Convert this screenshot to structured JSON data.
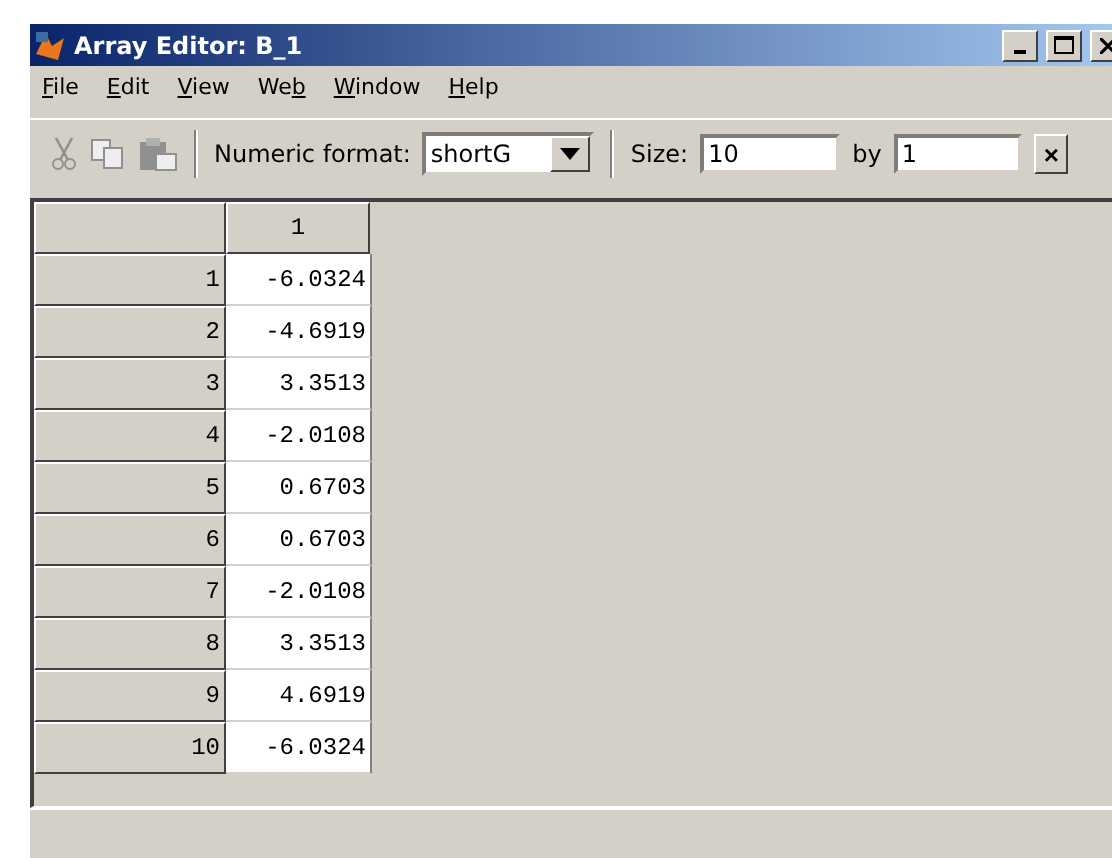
{
  "window": {
    "title": "Array Editor: B_1"
  },
  "menu": [
    {
      "parts": [
        {
          "text": "F",
          "underlined": true
        },
        {
          "text": "ile",
          "underlined": false
        }
      ]
    },
    {
      "parts": [
        {
          "text": "E",
          "underlined": true
        },
        {
          "text": "dit",
          "underlined": false
        }
      ]
    },
    {
      "parts": [
        {
          "text": "V",
          "underlined": true
        },
        {
          "text": "iew",
          "underlined": false
        }
      ]
    },
    {
      "parts": [
        {
          "text": "We",
          "underlined": false
        },
        {
          "text": "b",
          "underlined": true
        }
      ]
    },
    {
      "parts": [
        {
          "text": "W",
          "underlined": true
        },
        {
          "text": "indow",
          "underlined": false
        }
      ]
    },
    {
      "parts": [
        {
          "text": "H",
          "underlined": true
        },
        {
          "text": "elp",
          "underlined": false
        }
      ]
    }
  ],
  "toolbar": {
    "format_label": "Numeric format:",
    "format_value": "shortG",
    "size_label": "Size:",
    "rows_value": "10",
    "by_label": "by",
    "cols_value": "1",
    "close": "×"
  },
  "table": {
    "columns": [
      "1"
    ],
    "rows": [
      {
        "index": "1",
        "value": "-6.0324"
      },
      {
        "index": "2",
        "value": "-4.6919"
      },
      {
        "index": "3",
        "value": "3.3513"
      },
      {
        "index": "4",
        "value": "-2.0108"
      },
      {
        "index": "5",
        "value": "0.6703"
      },
      {
        "index": "6",
        "value": "0.6703"
      },
      {
        "index": "7",
        "value": "-2.0108"
      },
      {
        "index": "8",
        "value": "3.3513"
      },
      {
        "index": "9",
        "value": "4.6919"
      },
      {
        "index": "10",
        "value": "-6.0324"
      }
    ]
  }
}
